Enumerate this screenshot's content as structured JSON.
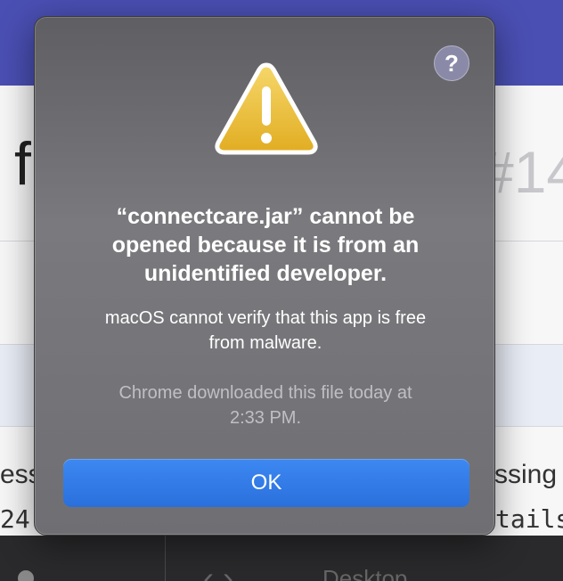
{
  "background": {
    "title_left": "f",
    "title_right": "#14",
    "text_left": "essa",
    "text_right": "ssing",
    "mono_left": "24",
    "mono_right": "tails",
    "dock_nav": "‹ ›",
    "dock_label": "Desktop"
  },
  "dialog": {
    "help_label": "?",
    "icon": "warning-icon",
    "title_lines": [
      "“connectcare.jar” cannot be",
      "opened because it is from an",
      "unidentified developer."
    ],
    "message_lines": [
      "macOS cannot verify that this app is free",
      "from malware."
    ],
    "detail_lines": [
      "Chrome downloaded this file today at",
      "2:33 PM."
    ],
    "ok_label": "OK"
  },
  "colors": {
    "accent": "#2f7bea",
    "warning": "#f0c53a"
  }
}
